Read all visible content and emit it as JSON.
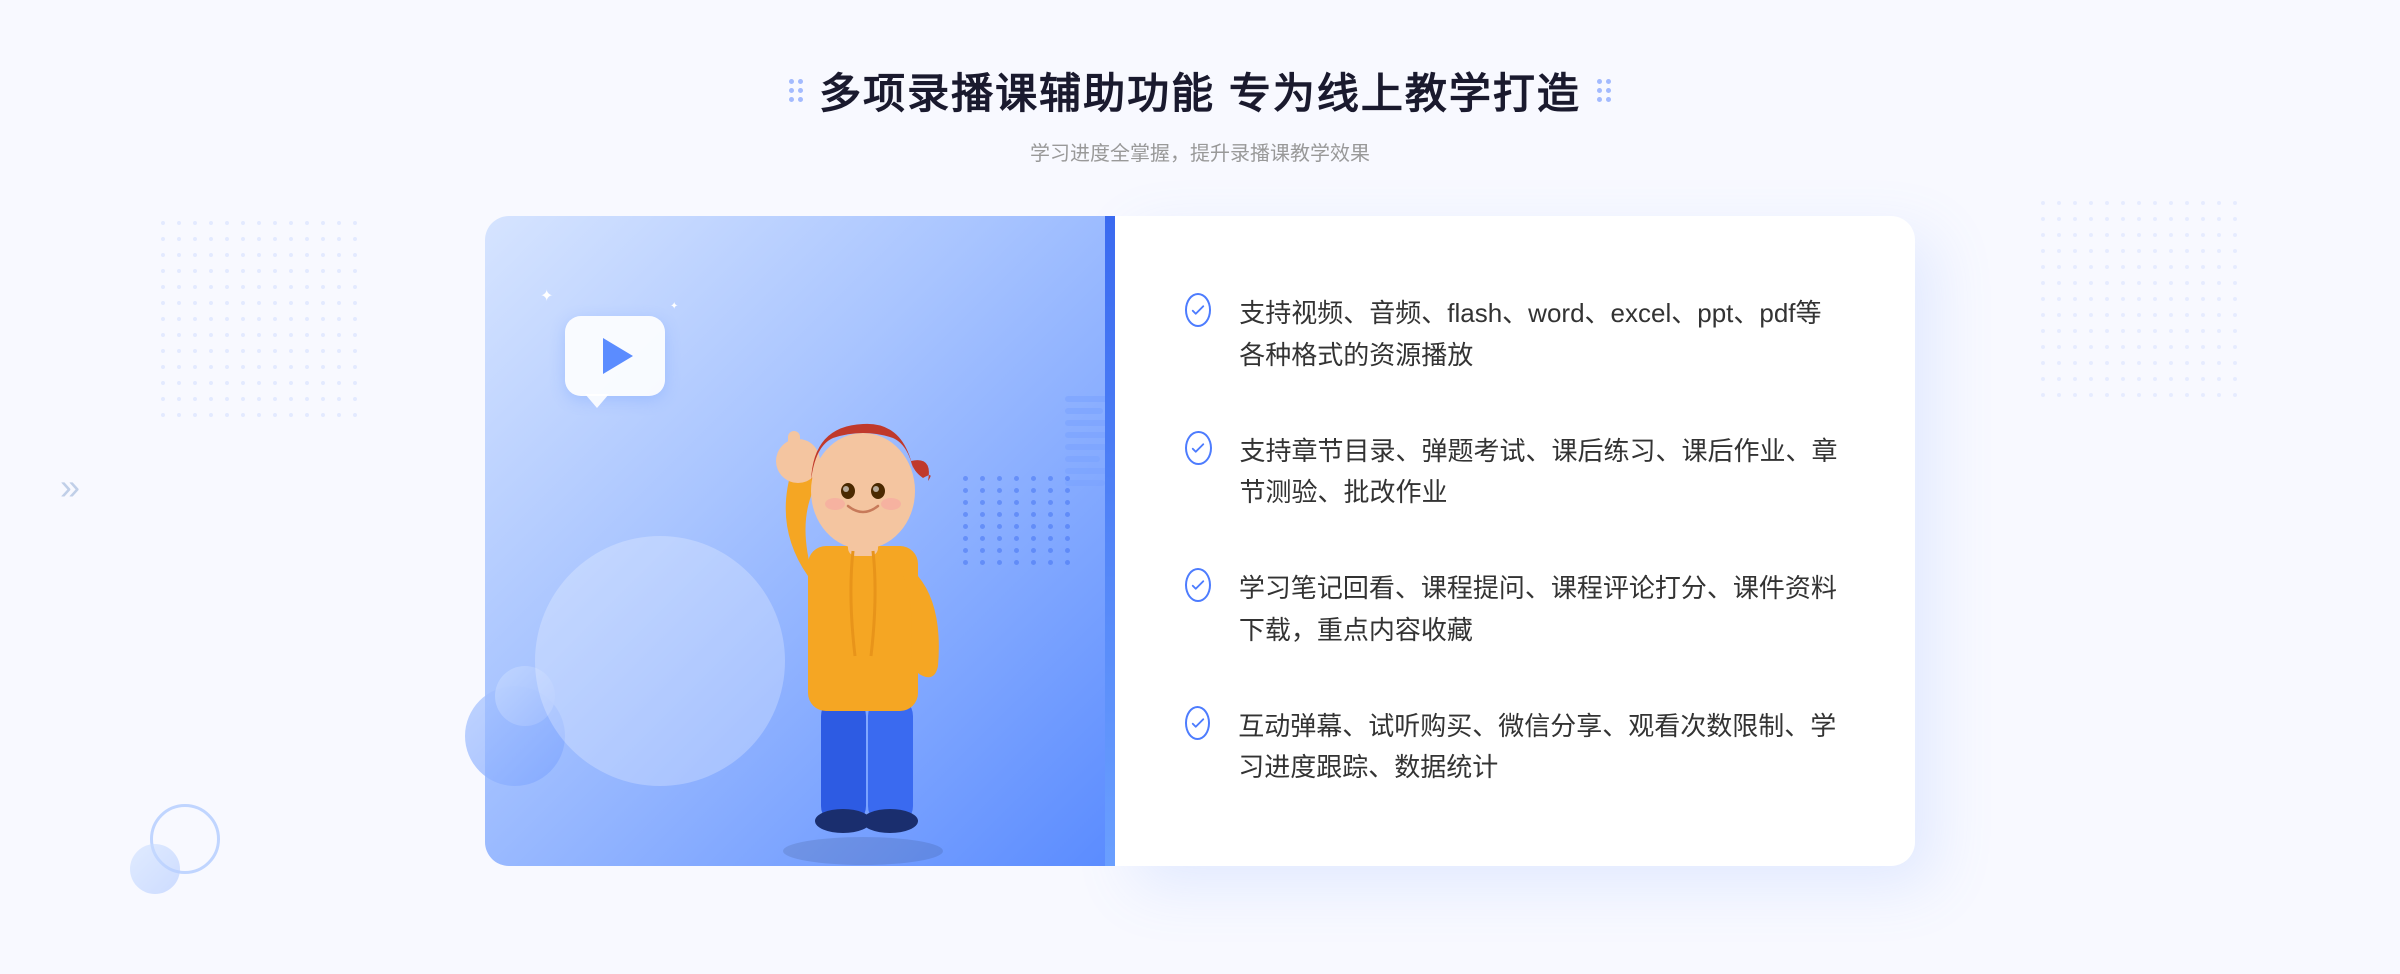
{
  "page": {
    "background_color": "#f5f7ff"
  },
  "header": {
    "title": "多项录播课辅助功能 专为线上教学打造",
    "subtitle": "学习进度全掌握，提升录播课教学效果",
    "dots_left": true,
    "dots_right": true
  },
  "features": [
    {
      "id": "feature-1",
      "text": "支持视频、音频、flash、word、excel、ppt、pdf等各种格式的资源播放"
    },
    {
      "id": "feature-2",
      "text": "支持章节目录、弹题考试、课后练习、课后作业、章节测验、批改作业"
    },
    {
      "id": "feature-3",
      "text": "学习笔记回看、课程提问、课程评论打分、课件资料下载，重点内容收藏"
    },
    {
      "id": "feature-4",
      "text": "互动弹幕、试听购买、微信分享、观看次数限制、学习进度跟踪、数据统计"
    }
  ],
  "decoration": {
    "left_chevron": "»",
    "play_label": "play",
    "check_icon": "check"
  }
}
